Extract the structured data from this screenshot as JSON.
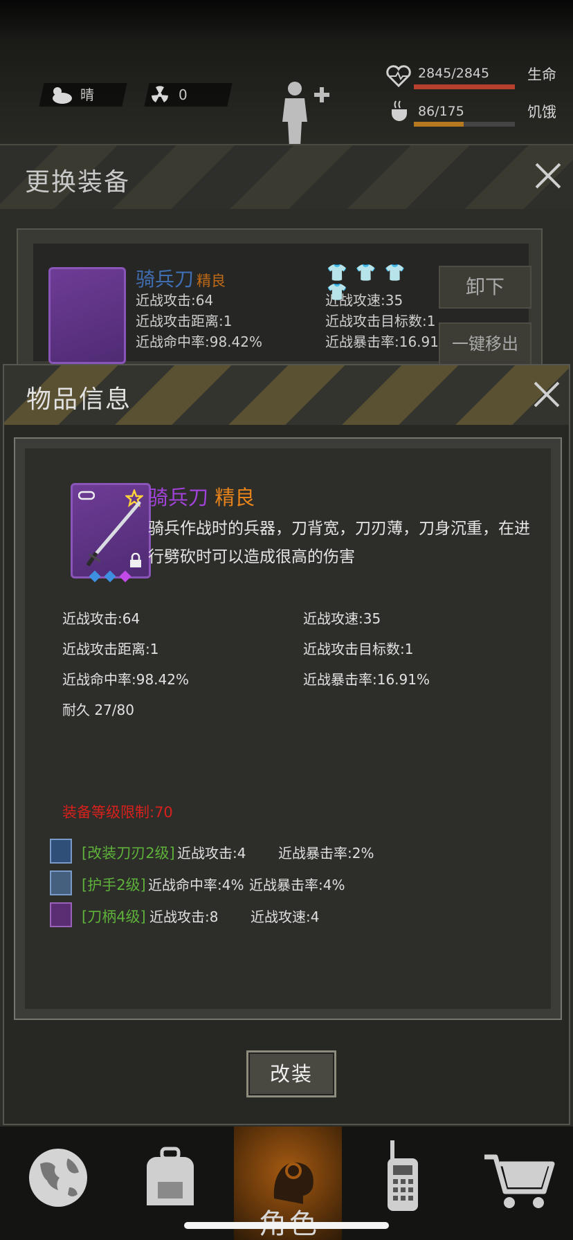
{
  "hud": {
    "weather": "晴",
    "radiation": "0",
    "health": {
      "value": "2845/2845",
      "label": "生命",
      "fill": 1.0,
      "color": "#b8402e"
    },
    "hunger": {
      "value": "86/175",
      "label": "饥饿",
      "fill": 0.49,
      "color": "#b6791f"
    }
  },
  "equipment_panel": {
    "title": "更换装备",
    "item_name": "骑兵刀",
    "item_quality": "精良",
    "stats": [
      "近战攻击:64",
      "近战攻速:35",
      "近战攻击距离:1",
      "近战攻击目标数:1",
      "近战命中率:98.42%",
      "近战暴击率:16.91%"
    ],
    "unequip_label": "卸下",
    "quick_move_label": "一键移出"
  },
  "item_info": {
    "title": "物品信息",
    "name": "骑兵刀",
    "quality": "精良",
    "description": "骑兵作战时的兵器，刀背宽，刀刃薄，刀身沉重，在进行劈砍时可以造成很高的伤害",
    "attributes": [
      "近战攻击:64",
      "近战攻速:35",
      "近战攻击距离:1",
      "近战攻击目标数:1",
      "近战命中率:98.42%",
      "近战暴击率:16.91%",
      "耐久 27/80"
    ],
    "level_requirement": "装备等级限制:70",
    "mods": [
      {
        "name": "[改装刀刃2级]",
        "stat1": "近战攻击:4",
        "stat2": "近战暴击率:2%"
      },
      {
        "name": "[护手2级]",
        "stat1": "近战命中率:4%",
        "stat2": "近战暴击率:4%"
      },
      {
        "name": "[刀柄4级]",
        "stat1": "近战攻击:8",
        "stat2": "近战攻速:4"
      }
    ],
    "refit_label": "改装"
  },
  "nav": {
    "active_label": "角色",
    "items": [
      "globe-icon",
      "backpack-icon",
      "character-icon",
      "radio-icon",
      "cart-icon"
    ]
  },
  "colors": {
    "quality_purple": "#a143d8",
    "quality_orange": "#e9841a",
    "mod_green": "#5eb23a",
    "requirement_red": "#d8211c"
  }
}
